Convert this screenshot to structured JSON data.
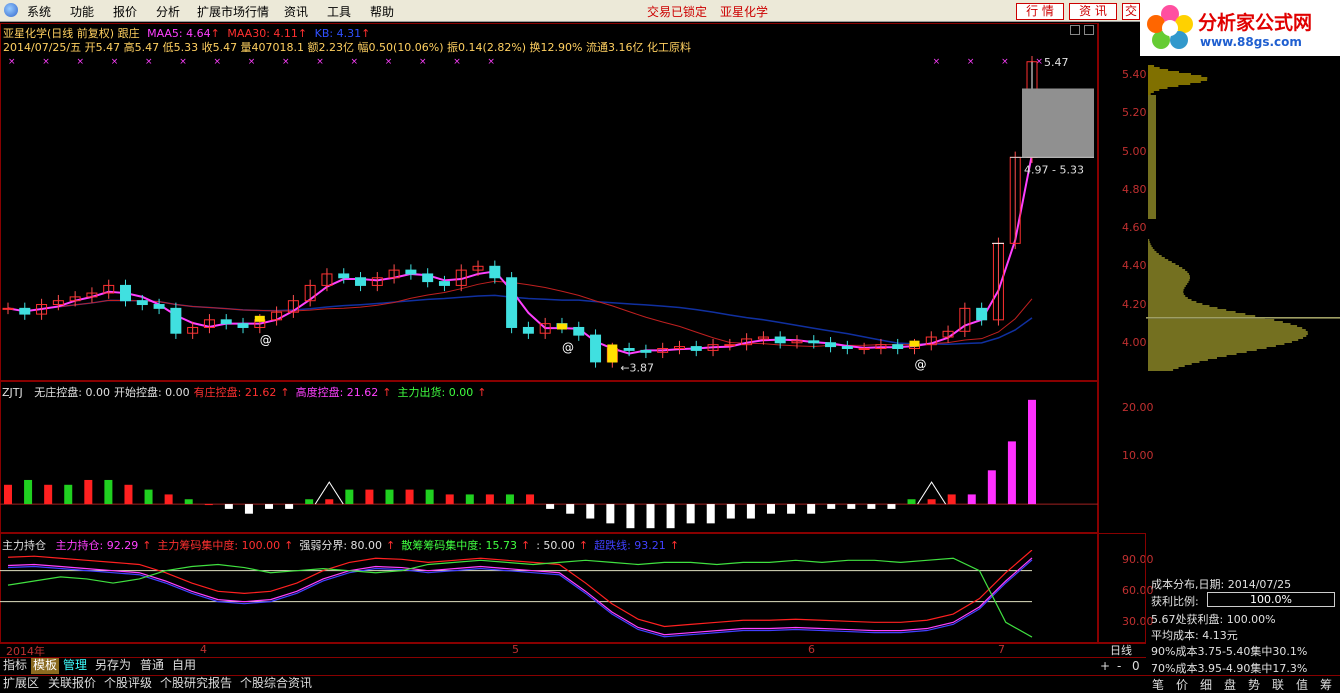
{
  "menu": {
    "system": "系统",
    "func": "功能",
    "quote": "报价",
    "analysis": "分析",
    "ext_market": "扩展市场行情",
    "info": "资讯",
    "tools": "工具",
    "help": "帮助"
  },
  "status": {
    "locked": "交易已锁定",
    "stock": "亚星化学"
  },
  "top_buttons": {
    "quote": "行 情",
    "info": "资 讯",
    "trade": "交"
  },
  "logo": {
    "title": "分析家公式网",
    "url": "www.88gs.com"
  },
  "main_chart": {
    "title": "亚星化学(日线 前复权) 跟庄",
    "ma5_label": "MAA5: 4.64",
    "ma30_label": "MAA30: 4.11",
    "ma60_label": "KB: 4.31",
    "info": "2014/07/25/五 开5.47 高5.47 低5.33 收5.47 量407018.1 额2.23亿 幅0.50(10.06%) 振0.14(2.82%) 换12.90% 流通3.16亿 化工原料",
    "y_ticks": [
      "5.40",
      "5.20",
      "5.00",
      "4.80",
      "4.60",
      "4.40",
      "4.20",
      "4.00"
    ],
    "high_label": "5.47",
    "low_label": "3.87",
    "range_label": "4.97 - 5.33",
    "at": "@"
  },
  "zjtj": {
    "name": "ZJTJ",
    "items": [
      "无庄控盘: 0.00",
      "开始控盘: 0.00",
      "有庄控盘: 21.62",
      "高度控盘: 21.62",
      "主力出货: 0.00"
    ],
    "colors": [
      "#e0e0e0",
      "#e0e0e0",
      "#ff3030",
      "#ff40ff",
      "#40ff40"
    ],
    "y_ticks": [
      "20.00",
      "10.00"
    ]
  },
  "hold": {
    "name": "主力持仓",
    "items": [
      "主力持仓: 92.29",
      "主力筹码集中度: 100.00",
      "强弱分界: 80.00",
      "散筹筹码集中度: 15.73",
      ": 50.00",
      "超跌线: 93.21"
    ],
    "colors": [
      "#ff40ff",
      "#ff3030",
      "#e0e0e0",
      "#40ff40",
      "#e0e0e0",
      "#4040ff"
    ],
    "y_ticks": [
      "90.00",
      "60.00",
      "30.00"
    ]
  },
  "date_axis": {
    "labels": [
      "2014年",
      "4",
      "5",
      "6",
      "7"
    ],
    "period": "日线"
  },
  "side": {
    "title": "成本分布,日期: 2014/07/25",
    "profit_ratio_label": "获利比例:",
    "profit_ratio": "100.0%",
    "profit_line": "5.67处获利盘: 100.00%",
    "avg_cost": "平均成本: 4.13元",
    "c90": "90%成本3.75-5.40集中30.1%",
    "c70": "70%成本3.95-4.90集中17.3%"
  },
  "tabs1": [
    "指标",
    "模板",
    "管理",
    "另存为",
    "普通",
    "自用"
  ],
  "tabs2": [
    "扩展区",
    "关联报价",
    "个股评级",
    "个股研究报告",
    "个股综合资讯"
  ],
  "side_tabs": [
    "笔",
    "价",
    "细",
    "盘",
    "势",
    "联",
    "值",
    "筹"
  ],
  "chart_data": [
    {
      "type": "candlestick",
      "title": "亚星化学(日线 前复权) 跟庄",
      "ylim": [
        3.8,
        5.5
      ],
      "close": [
        4.18,
        4.15,
        4.2,
        4.22,
        4.24,
        4.26,
        4.3,
        4.22,
        4.2,
        4.18,
        4.05,
        4.08,
        4.12,
        4.1,
        4.08,
        4.12,
        4.16,
        4.22,
        4.3,
        4.36,
        4.34,
        4.3,
        4.34,
        4.38,
        4.36,
        4.32,
        4.3,
        4.38,
        4.4,
        4.34,
        4.08,
        4.05,
        4.1,
        4.08,
        4.04,
        3.9,
        3.97,
        3.96,
        3.95,
        3.97,
        3.98,
        3.96,
        3.99,
        3.99,
        4.02,
        4.03,
        4.0,
        4.01,
        4.0,
        3.98,
        3.97,
        3.97,
        3.99,
        3.97,
        3.99,
        4.03,
        4.06,
        4.18,
        4.12,
        4.52,
        4.97,
        5.47
      ]
    },
    {
      "type": "bar",
      "title": "ZJTJ",
      "ylim": [
        -6,
        22
      ],
      "values": [
        4,
        5,
        4,
        4,
        5,
        5,
        4,
        3,
        2,
        1,
        0,
        -1,
        -2,
        -1,
        -1,
        1,
        1,
        3,
        3,
        3,
        3,
        3,
        2,
        2,
        2,
        2,
        2,
        -1,
        -2,
        -3,
        -4,
        -5,
        -5,
        -5,
        -4,
        -4,
        -3,
        -3,
        -2,
        -2,
        -2,
        -1,
        -1,
        -1,
        -1,
        1,
        1,
        2,
        2,
        7,
        13,
        21.62
      ]
    },
    {
      "type": "line",
      "title": "主力持仓",
      "ylim": [
        10,
        100
      ],
      "series": [
        {
          "name": "主力持仓",
          "values": [
            85,
            86,
            84,
            82,
            80,
            78,
            70,
            60,
            52,
            50,
            52,
            60,
            72,
            80,
            84,
            83,
            80,
            82,
            84,
            82,
            80,
            78,
            60,
            40,
            25,
            18,
            20,
            22,
            24,
            24,
            25,
            24,
            23,
            22,
            22,
            24,
            30,
            45,
            70,
            92.29
          ]
        },
        {
          "name": "散筹筹码集中度",
          "values": [
            66,
            70,
            74,
            72,
            68,
            72,
            80,
            84,
            86,
            83,
            78,
            80,
            82,
            80,
            78,
            80,
            86,
            88,
            90,
            88,
            86,
            88,
            90,
            88,
            86,
            88,
            88,
            86,
            88,
            88,
            90,
            88,
            90,
            90,
            88,
            90,
            92,
            80,
            30,
            15.73
          ]
        }
      ]
    }
  ]
}
